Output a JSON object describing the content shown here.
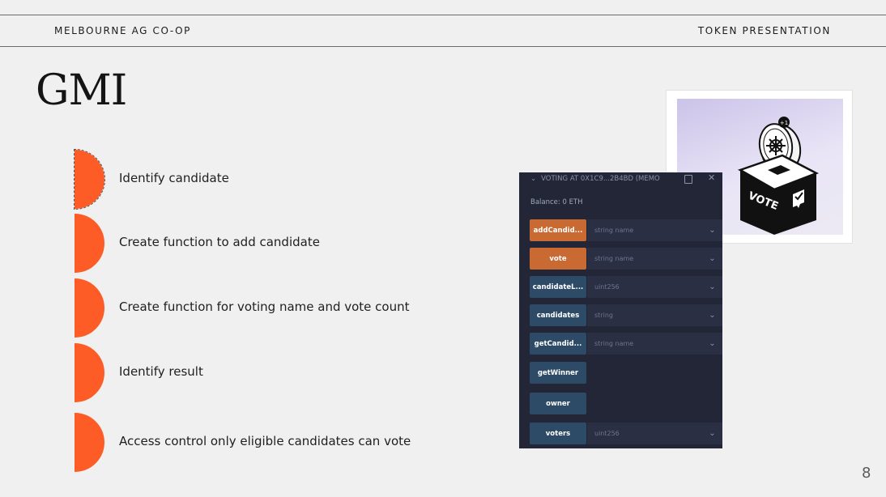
{
  "header": {
    "org": "MELBOURNE AG CO-OP",
    "section": "TOKEN  PRESENTATION"
  },
  "title": "GMI",
  "steps": [
    {
      "label": "Identify candidate"
    },
    {
      "label": "Create function to add candidate"
    },
    {
      "label": "Create function for voting name and vote count"
    },
    {
      "label": "Identify result"
    },
    {
      "label": "Access control only eligible candidates can vote"
    }
  ],
  "image": {
    "vote_text": "VOTE",
    "badge_text": "+1"
  },
  "contract_panel": {
    "title": "VOTING AT 0X1C9...2B4BD (MEMO",
    "balance": "Balance: 0 ETH",
    "functions": [
      {
        "name": "addCandid...",
        "param": "string name",
        "kind": "transact"
      },
      {
        "name": "vote",
        "param": "string name",
        "kind": "transact"
      },
      {
        "name": "candidateL...",
        "param": "uint256",
        "kind": "call"
      },
      {
        "name": "candidates",
        "param": "string",
        "kind": "call"
      },
      {
        "name": "getCandid...",
        "param": "string name",
        "kind": "call"
      },
      {
        "name": "getWinner",
        "param": "",
        "kind": "call"
      },
      {
        "name": "owner",
        "param": "",
        "kind": "call"
      },
      {
        "name": "voters",
        "param": "uint256",
        "kind": "call"
      }
    ],
    "colors": {
      "transact": "#c96a33",
      "call": "#2d4b67"
    }
  },
  "page_number": "8",
  "accent_color": "#fd5c27"
}
